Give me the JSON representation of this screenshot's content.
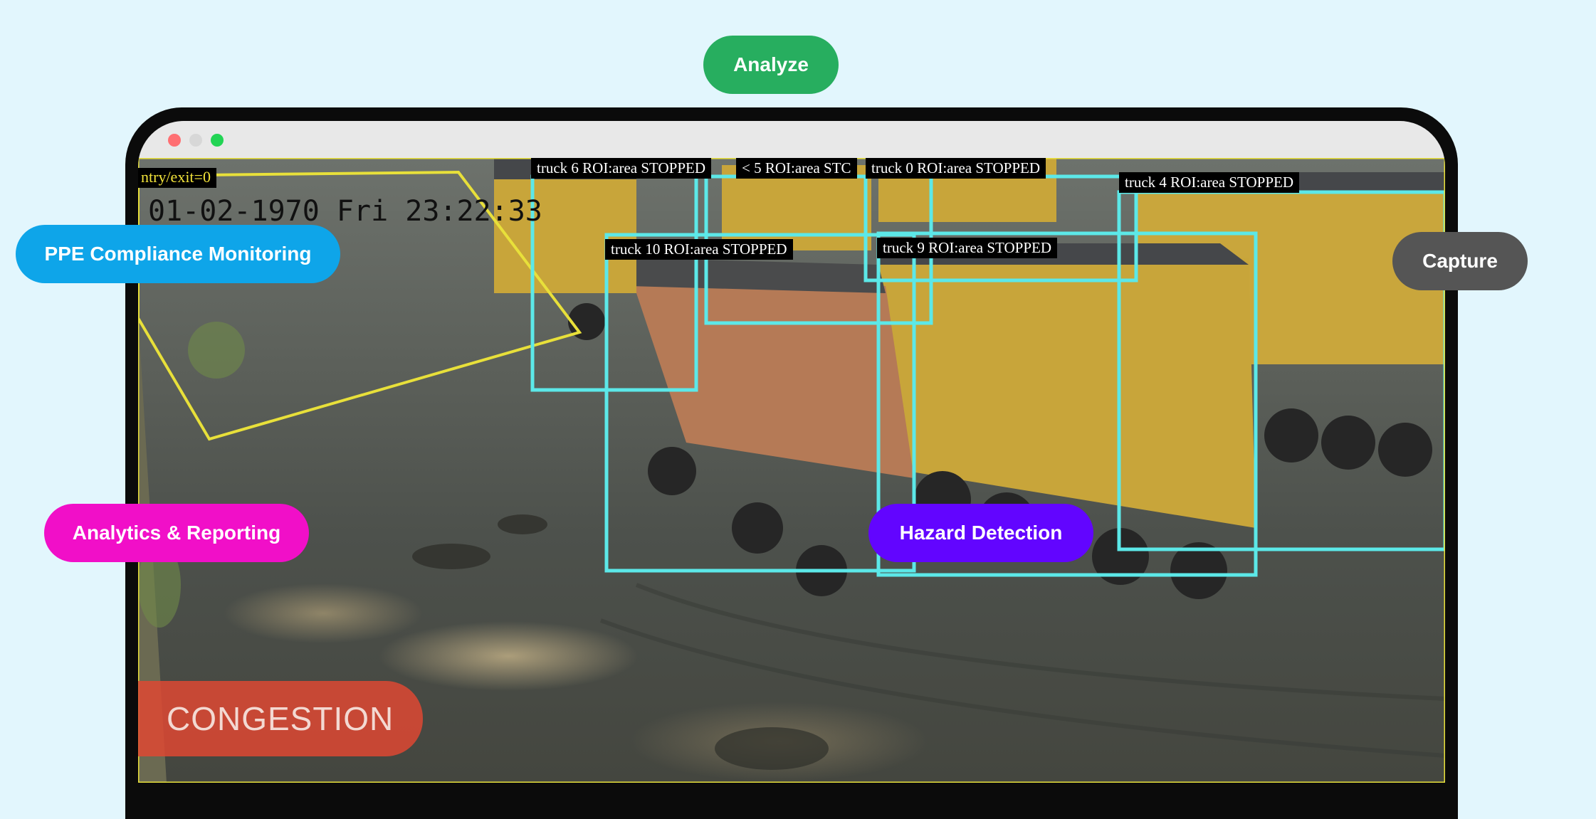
{
  "buttons": {
    "analyze": "Analyze",
    "ppe": "PPE Compliance Monitoring",
    "capture": "Capture",
    "analytics": "Analytics & Reporting",
    "hazard": "Hazard Detection"
  },
  "feed": {
    "timestamp": "01-02-1970 Fri 23:22:33",
    "entry_exit": "ntry/exit=0",
    "alert": "CONGESTION",
    "detections": [
      {
        "label": "truck 6  ROI:area STOPPED"
      },
      {
        "label": "< 5  ROI:area STC"
      },
      {
        "label": "truck 0  ROI:area STOPPED"
      },
      {
        "label": "truck 4  ROI:area STOPPED"
      },
      {
        "label": "truck 10  ROI:area STOPPED"
      },
      {
        "label": "truck 9  ROI:area STOPPED"
      }
    ]
  },
  "colors": {
    "background": "#e2f6fd",
    "analyze": "#27ae5f",
    "ppe": "#0ea5e9",
    "capture": "#555555",
    "analytics": "#f10fc8",
    "hazard": "#6205ff",
    "detection_box": "#5ce8e8",
    "roi_polygon": "#e8e03a",
    "congestion": "#de4832"
  }
}
